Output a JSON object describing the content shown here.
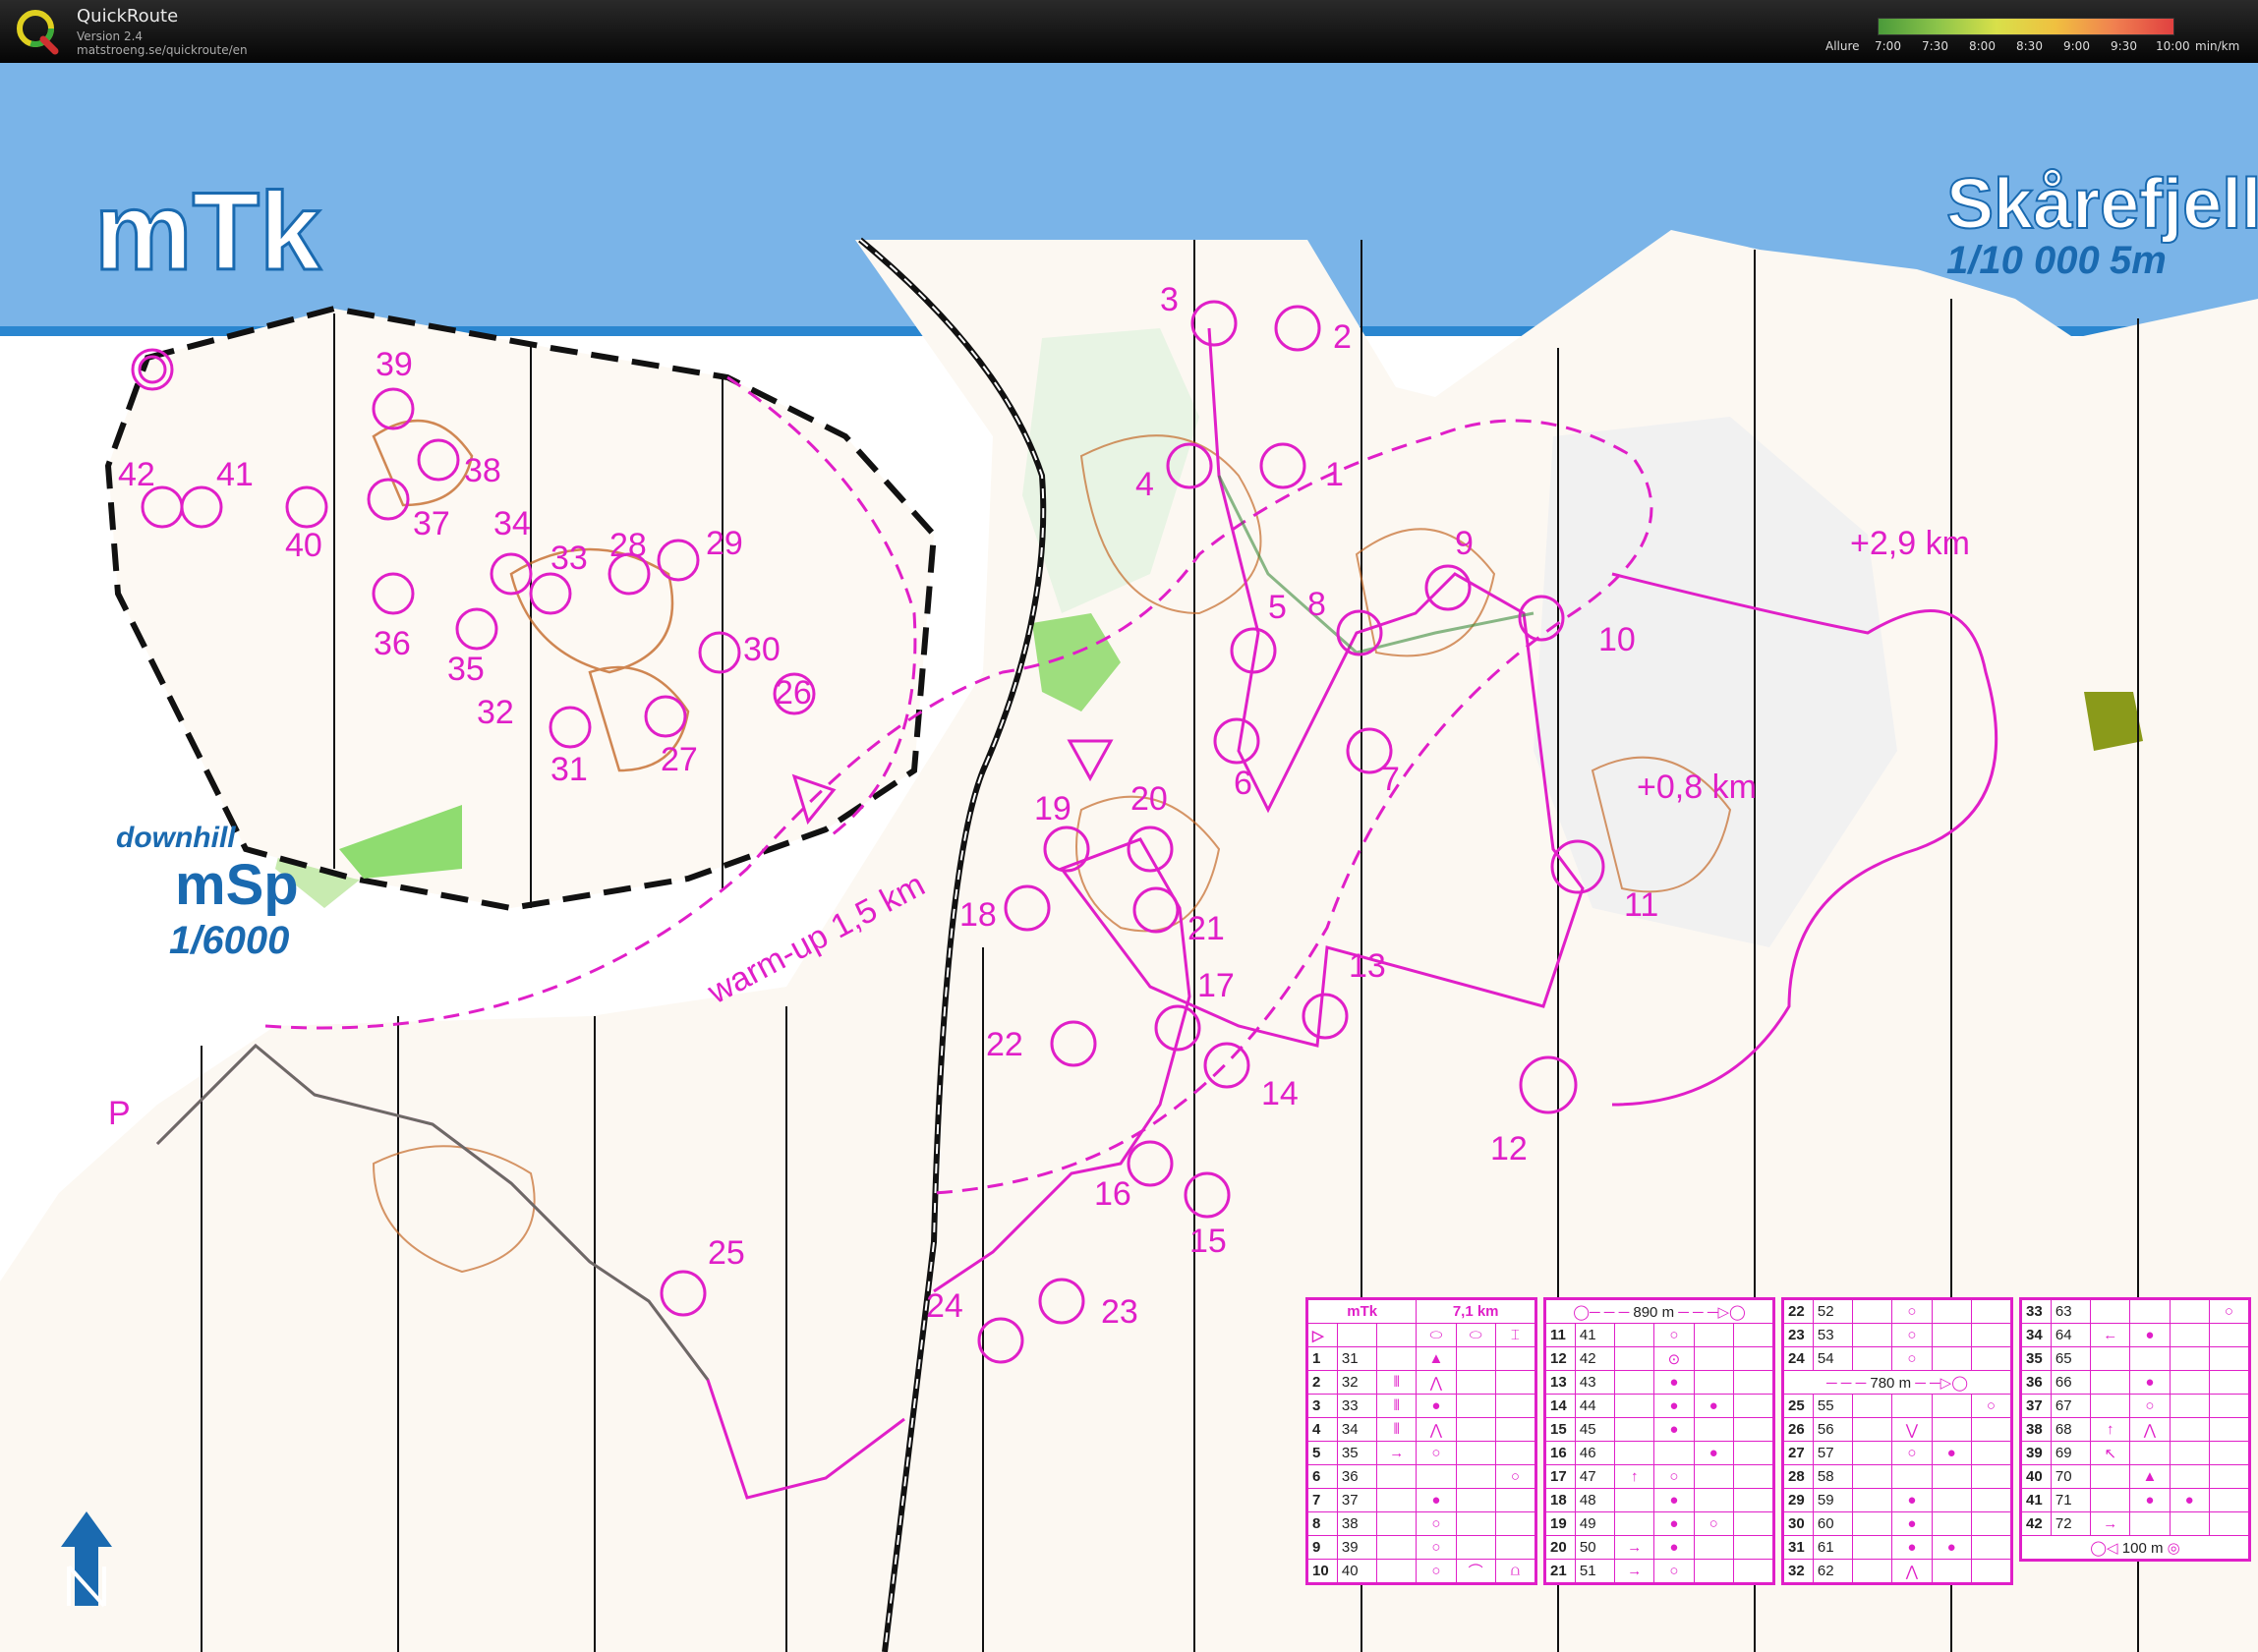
{
  "app": {
    "name": "QuickRoute",
    "version": "Version 2.4",
    "url": "matstroeng.se/quickroute/en"
  },
  "pace_legend": {
    "label": "Allure",
    "ticks": [
      "7:00",
      "7:30",
      "8:00",
      "8:30",
      "9:00",
      "9:30",
      "10:00"
    ],
    "unit": "min/km",
    "colors": [
      "#4a9a3a",
      "#8cc44a",
      "#d8e04a",
      "#f0c040",
      "#f08050",
      "#e04040"
    ]
  },
  "map": {
    "header_color": "#7ab4e8",
    "course_color": "#e01fc8",
    "title": "mTk",
    "area_name": "Skårefjell",
    "scale": "1/10 000",
    "contour": "5m",
    "inset_label_1": "downhill",
    "inset_label_2": "mSp",
    "inset_scale": "1/6000",
    "parking": "P",
    "warmup": "warm-up 1,5 km",
    "extra_1": "+2,9 km",
    "extra_2": "+0,8 km",
    "controls": [
      "1",
      "2",
      "3",
      "4",
      "5",
      "6",
      "7",
      "8",
      "9",
      "10",
      "11",
      "12",
      "13",
      "14",
      "15",
      "16",
      "17",
      "18",
      "19",
      "20",
      "21",
      "22",
      "23",
      "24",
      "25",
      "26",
      "27",
      "28",
      "29",
      "30",
      "31",
      "32",
      "33",
      "34",
      "35",
      "36",
      "37",
      "38",
      "39",
      "40",
      "41",
      "42"
    ]
  },
  "descriptions": {
    "header": {
      "course": "mTk",
      "length": "7,1 km"
    },
    "leg_1": "890 m",
    "leg_2": "780 m",
    "leg_3": "100 m",
    "col1": [
      {
        "n": "1",
        "c": "31",
        "s1": "",
        "s2": "▲",
        "s3": "",
        "s4": ""
      },
      {
        "n": "2",
        "c": "32",
        "s1": "⫴",
        "s2": "⋀",
        "s3": "",
        "s4": ""
      },
      {
        "n": "3",
        "c": "33",
        "s1": "⫴",
        "s2": "●",
        "s3": "",
        "s4": ""
      },
      {
        "n": "4",
        "c": "34",
        "s1": "⫴",
        "s2": "⋀",
        "s3": "",
        "s4": ""
      },
      {
        "n": "5",
        "c": "35",
        "s1": "→",
        "s2": "○",
        "s3": "",
        "s4": ""
      },
      {
        "n": "6",
        "c": "36",
        "s1": "",
        "s2": "",
        "s3": "",
        "s4": "○"
      },
      {
        "n": "7",
        "c": "37",
        "s1": "",
        "s2": "●",
        "s3": "",
        "s4": ""
      },
      {
        "n": "8",
        "c": "38",
        "s1": "",
        "s2": "○",
        "s3": "",
        "s4": ""
      },
      {
        "n": "9",
        "c": "39",
        "s1": "",
        "s2": "○",
        "s3": "",
        "s4": ""
      },
      {
        "n": "10",
        "c": "40",
        "s1": "",
        "s2": "○",
        "s3": "⌒",
        "s4": "⩍"
      }
    ],
    "col2": [
      {
        "n": "11",
        "c": "41",
        "s1": "",
        "s2": "○",
        "s3": "",
        "s4": ""
      },
      {
        "n": "12",
        "c": "42",
        "s1": "",
        "s2": "⊙",
        "s3": "",
        "s4": ""
      },
      {
        "n": "13",
        "c": "43",
        "s1": "",
        "s2": "●",
        "s3": "",
        "s4": ""
      },
      {
        "n": "14",
        "c": "44",
        "s1": "",
        "s2": "●",
        "s3": "●",
        "s4": ""
      },
      {
        "n": "15",
        "c": "45",
        "s1": "",
        "s2": "●",
        "s3": "",
        "s4": ""
      },
      {
        "n": "16",
        "c": "46",
        "s1": "",
        "s2": "",
        "s3": "●",
        "s4": ""
      },
      {
        "n": "17",
        "c": "47",
        "s1": "↑",
        "s2": "○",
        "s3": "",
        "s4": ""
      },
      {
        "n": "18",
        "c": "48",
        "s1": "",
        "s2": "●",
        "s3": "",
        "s4": ""
      },
      {
        "n": "19",
        "c": "49",
        "s1": "",
        "s2": "●",
        "s3": "○",
        "s4": ""
      },
      {
        "n": "20",
        "c": "50",
        "s1": "→",
        "s2": "●",
        "s3": "",
        "s4": ""
      },
      {
        "n": "21",
        "c": "51",
        "s1": "→",
        "s2": "○",
        "s3": "",
        "s4": ""
      }
    ],
    "col3": [
      {
        "n": "22",
        "c": "52",
        "s1": "",
        "s2": "○",
        "s3": "",
        "s4": ""
      },
      {
        "n": "23",
        "c": "53",
        "s1": "",
        "s2": "○",
        "s3": "",
        "s4": ""
      },
      {
        "n": "24",
        "c": "54",
        "s1": "",
        "s2": "○",
        "s3": "",
        "s4": ""
      },
      {
        "n": "25",
        "c": "55",
        "s1": "",
        "s2": "",
        "s3": "",
        "s4": "○"
      },
      {
        "n": "26",
        "c": "56",
        "s1": "",
        "s2": "⋁",
        "s3": "",
        "s4": ""
      },
      {
        "n": "27",
        "c": "57",
        "s1": "",
        "s2": "○",
        "s3": "●",
        "s4": ""
      },
      {
        "n": "28",
        "c": "58",
        "s1": "",
        "s2": "",
        "s3": "",
        "s4": ""
      },
      {
        "n": "29",
        "c": "59",
        "s1": "",
        "s2": "●",
        "s3": "",
        "s4": ""
      },
      {
        "n": "30",
        "c": "60",
        "s1": "",
        "s2": "●",
        "s3": "",
        "s4": ""
      },
      {
        "n": "31",
        "c": "61",
        "s1": "",
        "s2": "●",
        "s3": "●",
        "s4": ""
      },
      {
        "n": "32",
        "c": "62",
        "s1": "",
        "s2": "⋀",
        "s3": "",
        "s4": ""
      }
    ],
    "col4": [
      {
        "n": "33",
        "c": "63",
        "s1": "",
        "s2": "",
        "s3": "",
        "s4": "○"
      },
      {
        "n": "34",
        "c": "64",
        "s1": "←",
        "s2": "●",
        "s3": "",
        "s4": ""
      },
      {
        "n": "35",
        "c": "65",
        "s1": "",
        "s2": "",
        "s3": "",
        "s4": ""
      },
      {
        "n": "36",
        "c": "66",
        "s1": "",
        "s2": "●",
        "s3": "",
        "s4": ""
      },
      {
        "n": "37",
        "c": "67",
        "s1": "",
        "s2": "○",
        "s3": "",
        "s4": ""
      },
      {
        "n": "38",
        "c": "68",
        "s1": "↑",
        "s2": "⋀",
        "s3": "",
        "s4": ""
      },
      {
        "n": "39",
        "c": "69",
        "s1": "↖",
        "s2": "",
        "s3": "",
        "s4": ""
      },
      {
        "n": "40",
        "c": "70",
        "s1": "",
        "s2": "▲",
        "s3": "",
        "s4": ""
      },
      {
        "n": "41",
        "c": "71",
        "s1": "",
        "s2": "●",
        "s3": "●",
        "s4": ""
      },
      {
        "n": "42",
        "c": "72",
        "s1": "→",
        "s2": "",
        "s3": "",
        "s4": ""
      }
    ]
  }
}
